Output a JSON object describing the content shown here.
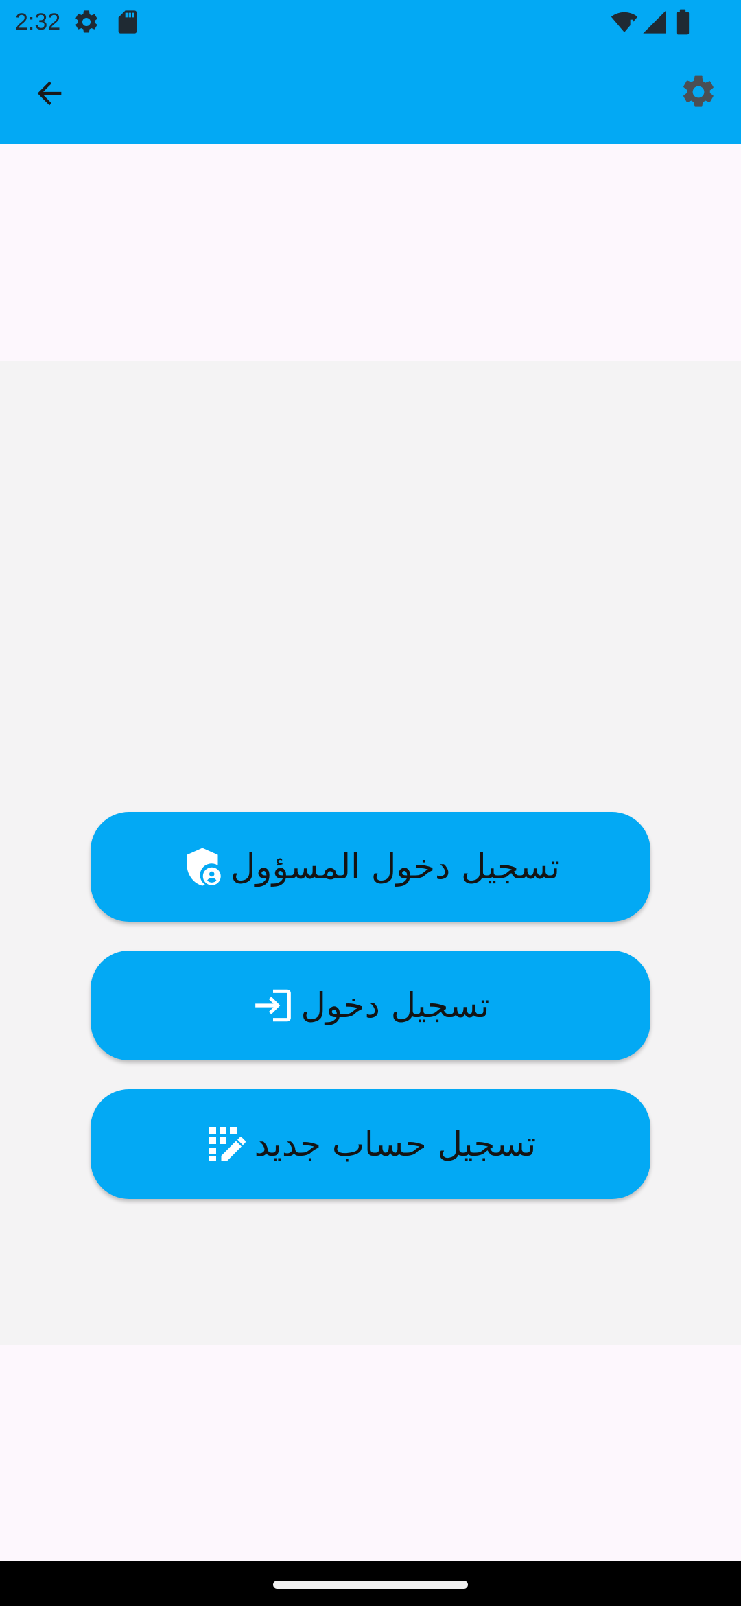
{
  "status_bar": {
    "time": "2:32",
    "icons": [
      "settings-gear-icon",
      "sd-card-icon",
      "wifi-icon",
      "signal-icon",
      "battery-icon"
    ]
  },
  "app_bar": {
    "back_icon": "arrow-back-icon",
    "settings_icon": "gear-icon",
    "background_color": "#03a9f4"
  },
  "buttons": [
    {
      "id": "admin-login",
      "label": "تسجيل دخول المسؤول",
      "icon": "admin-shield-icon"
    },
    {
      "id": "login",
      "label": "تسجيل دخول",
      "icon": "login-icon"
    },
    {
      "id": "register",
      "label": "تسجيل حساب جديد",
      "icon": "app-registration-icon"
    }
  ],
  "colors": {
    "accent": "#03a9f4",
    "content_background": "#f4f3f4",
    "page_background": "#fdf7fd"
  }
}
